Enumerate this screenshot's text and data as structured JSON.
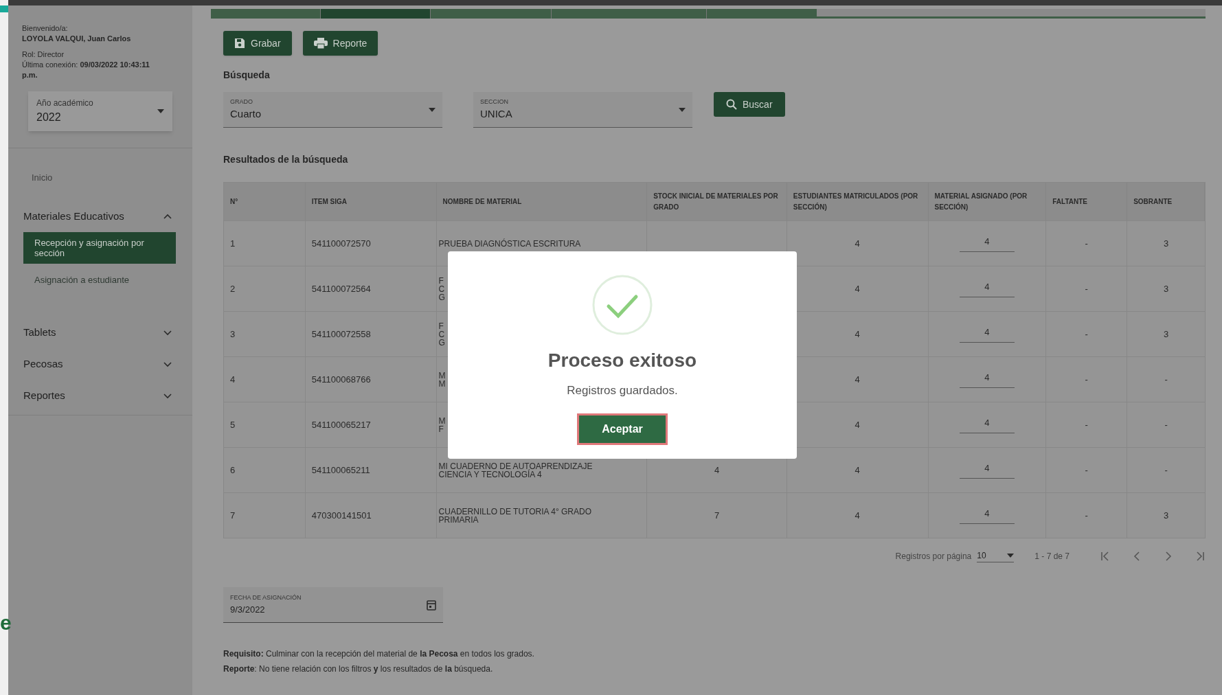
{
  "edge_fragment": "e",
  "user": {
    "greeting": "Bienvenido/a:",
    "name": "LOYOLA VALQUI, Juan Carlos",
    "role": "Rol: Director",
    "last_login_label": "Última conexión:",
    "last_login": "09/03/2022 10:43:11 p.m."
  },
  "year_select": {
    "label": "Año académico",
    "value": "2022"
  },
  "sidebar": [
    {
      "kind": "link",
      "label": "Inicio"
    },
    {
      "kind": "group",
      "label": "Materiales Educativos",
      "expanded": true,
      "children": [
        {
          "label": "Recepción y asignación por sección",
          "selected": true
        },
        {
          "label": "Asignación a estudiante",
          "selected": false
        }
      ]
    },
    {
      "kind": "group",
      "label": "Tablets",
      "expanded": false
    },
    {
      "kind": "group",
      "label": "Pecosas",
      "expanded": false
    },
    {
      "kind": "group",
      "label": "Reportes",
      "expanded": false
    }
  ],
  "toolbar": [
    {
      "kind": "save",
      "label": "Grabar"
    },
    {
      "kind": "print",
      "label": "Reporte"
    }
  ],
  "search": {
    "title": "Búsqueda",
    "grado": {
      "label": "GRADO",
      "value": "Cuarto"
    },
    "seccion": {
      "label": "SECCION",
      "value": "UNICA"
    },
    "button": "Buscar"
  },
  "results": {
    "title": "Resultados de la búsqueda",
    "columns": [
      "N°",
      "ITEM SIGA",
      "NOMBRE DE MATERIAL",
      "STOCK INICIAL DE MATERIALES POR GRADO",
      "ESTUDIANTES MATRICULADOS (POR SECCIÓN)",
      "MATERIAL ASIGNADO (POR SECCIÓN)",
      "FALTANTE",
      "SOBRANTE"
    ],
    "rows": [
      {
        "n": "1",
        "item": "541100072570",
        "name": [
          "PRUEBA DIAGNÓSTICA ESCRITURA"
        ],
        "students": "4",
        "assigned": "4",
        "missing": "-",
        "surplus": "3"
      },
      {
        "n": "2",
        "item": "541100072564",
        "name": [
          "F",
          "C",
          "G"
        ],
        "students": "4",
        "assigned": "4",
        "missing": "-",
        "surplus": "3"
      },
      {
        "n": "3",
        "item": "541100072558",
        "name": [
          "F",
          "C",
          "G"
        ],
        "students": "4",
        "assigned": "4",
        "missing": "-",
        "surplus": "3"
      },
      {
        "n": "4",
        "item": "541100068766",
        "name": [
          "M",
          "M"
        ],
        "students": "4",
        "assigned": "4",
        "missing": "-",
        "surplus": "-"
      },
      {
        "n": "5",
        "item": "541100065217",
        "name": [
          "M",
          "F"
        ],
        "students": "4",
        "assigned": "4",
        "missing": "-",
        "surplus": "-"
      },
      {
        "n": "6",
        "item": "541100065211",
        "name": [
          "MI CUADERNO DE AUTOAPRENDIZAJE",
          "CIENCIA Y TECNOLOGÍA 4"
        ],
        "stock": "4",
        "students": "4",
        "assigned": "4",
        "missing": "-",
        "surplus": "-"
      },
      {
        "n": "7",
        "item": "470300141501",
        "name": [
          "CUADERNILLO DE TUTORIA 4° GRADO",
          "PRIMARIA"
        ],
        "stock": "7",
        "students": "4",
        "assigned": "4",
        "missing": "-",
        "surplus": "3"
      }
    ],
    "pagination": {
      "per_page_label": "Registros por página",
      "per_page": "10",
      "range": "1 - 7 de 7"
    }
  },
  "date_field": {
    "label": "FECHA DE ASIGNACIÓN",
    "value": "9/3/2022"
  },
  "notes": [
    "**Requisito:** Culminar con la recepción del material de **la Pecosa** en todos los grados.",
    "**Reporte**: No tiene relación con los filtros **y** los resultados de **la** búsqueda."
  ],
  "dialog": {
    "title": "Proceso exitoso",
    "message": "Registros guardados.",
    "button": "Aceptar"
  }
}
